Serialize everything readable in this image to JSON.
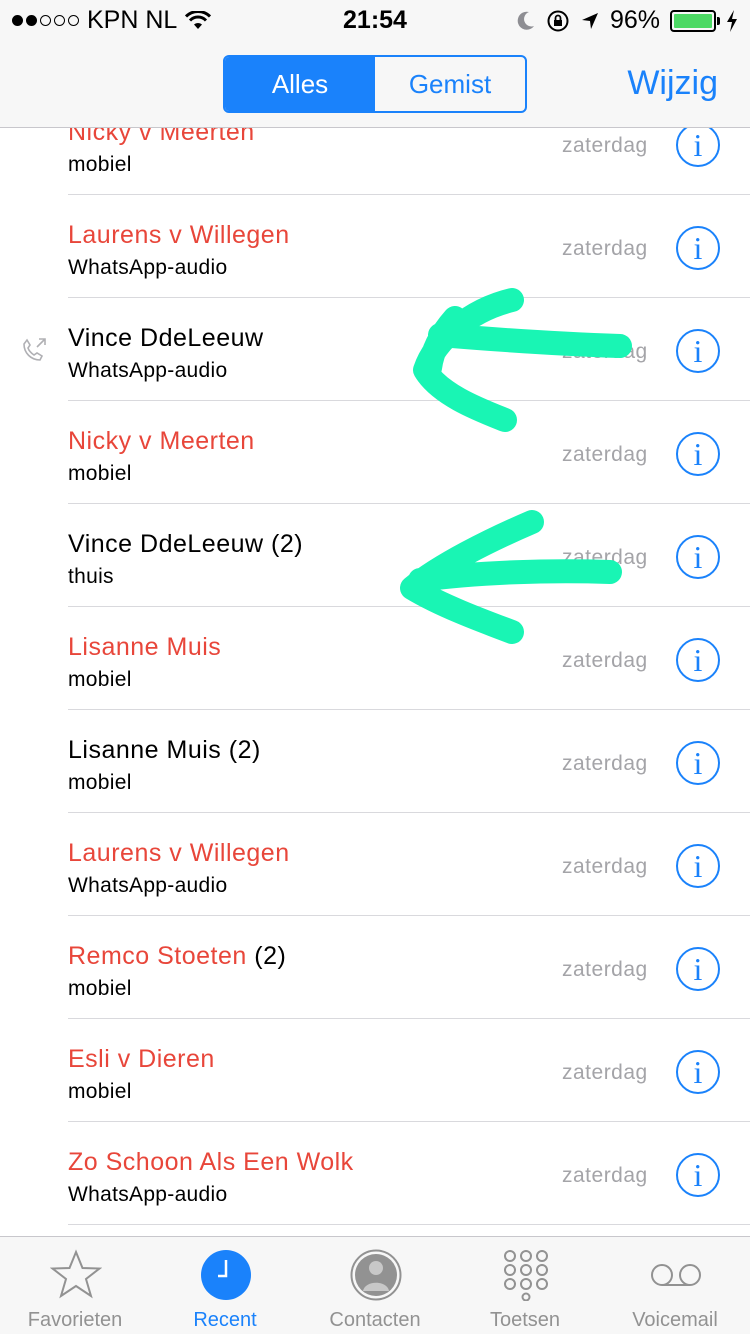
{
  "status_bar": {
    "carrier": "KPN NL",
    "time": "21:54",
    "battery": "96%",
    "battery_level": 0.96
  },
  "header": {
    "segments": [
      "Alles",
      "Gemist"
    ],
    "selected_segment": "Alles",
    "edit_label": "Wijzig"
  },
  "calls": [
    {
      "name": "Nicky v Meerten",
      "count": "",
      "type": "mobiel",
      "date": "zaterdag",
      "missed": true
    },
    {
      "name": "Laurens v Willegen",
      "count": "",
      "type": "WhatsApp-audio",
      "date": "zaterdag",
      "missed": true
    },
    {
      "name": "Vince DdeLeeuw",
      "count": "",
      "type": "WhatsApp-audio",
      "date": "zaterdag",
      "missed": false
    },
    {
      "name": "Nicky v Meerten",
      "count": "",
      "type": "mobiel",
      "date": "zaterdag",
      "missed": true
    },
    {
      "name": "Vince DdeLeeuw",
      "count": " (2)",
      "type": "thuis",
      "date": "zaterdag",
      "missed": false
    },
    {
      "name": "Lisanne Muis",
      "count": "",
      "type": "mobiel",
      "date": "zaterdag",
      "missed": true
    },
    {
      "name": "Lisanne Muis",
      "count": " (2)",
      "type": "mobiel",
      "date": "zaterdag",
      "missed": false
    },
    {
      "name": "Laurens v Willegen",
      "count": "",
      "type": "WhatsApp-audio",
      "date": "zaterdag",
      "missed": true
    },
    {
      "name": "Remco Stoeten",
      "count": " (2)",
      "type": "mobiel",
      "date": "zaterdag",
      "missed": true
    },
    {
      "name": "Esli v Dieren",
      "count": "",
      "type": "mobiel",
      "date": "zaterdag",
      "missed": true
    },
    {
      "name": "Zo Schoon Als Een Wolk",
      "count": "",
      "type": "WhatsApp-audio",
      "date": "zaterdag",
      "missed": true
    }
  ],
  "icons": {
    "info": "info-icon",
    "outgoing_call": "outgoing-call-icon"
  },
  "tabs": [
    {
      "label": "Favorieten",
      "icon": "star-icon",
      "active": false
    },
    {
      "label": "Recent",
      "icon": "clock-icon",
      "active": true
    },
    {
      "label": "Contacten",
      "icon": "contact-icon",
      "active": false
    },
    {
      "label": "Toetsen",
      "icon": "keypad-icon",
      "active": false
    },
    {
      "label": "Voicemail",
      "icon": "voicemail-icon",
      "active": false
    }
  ],
  "colors": {
    "accent": "#1a82fb",
    "missed": "#e8463a",
    "annotation": "#19f5b4",
    "secondary_text": "#a4a4a8"
  }
}
